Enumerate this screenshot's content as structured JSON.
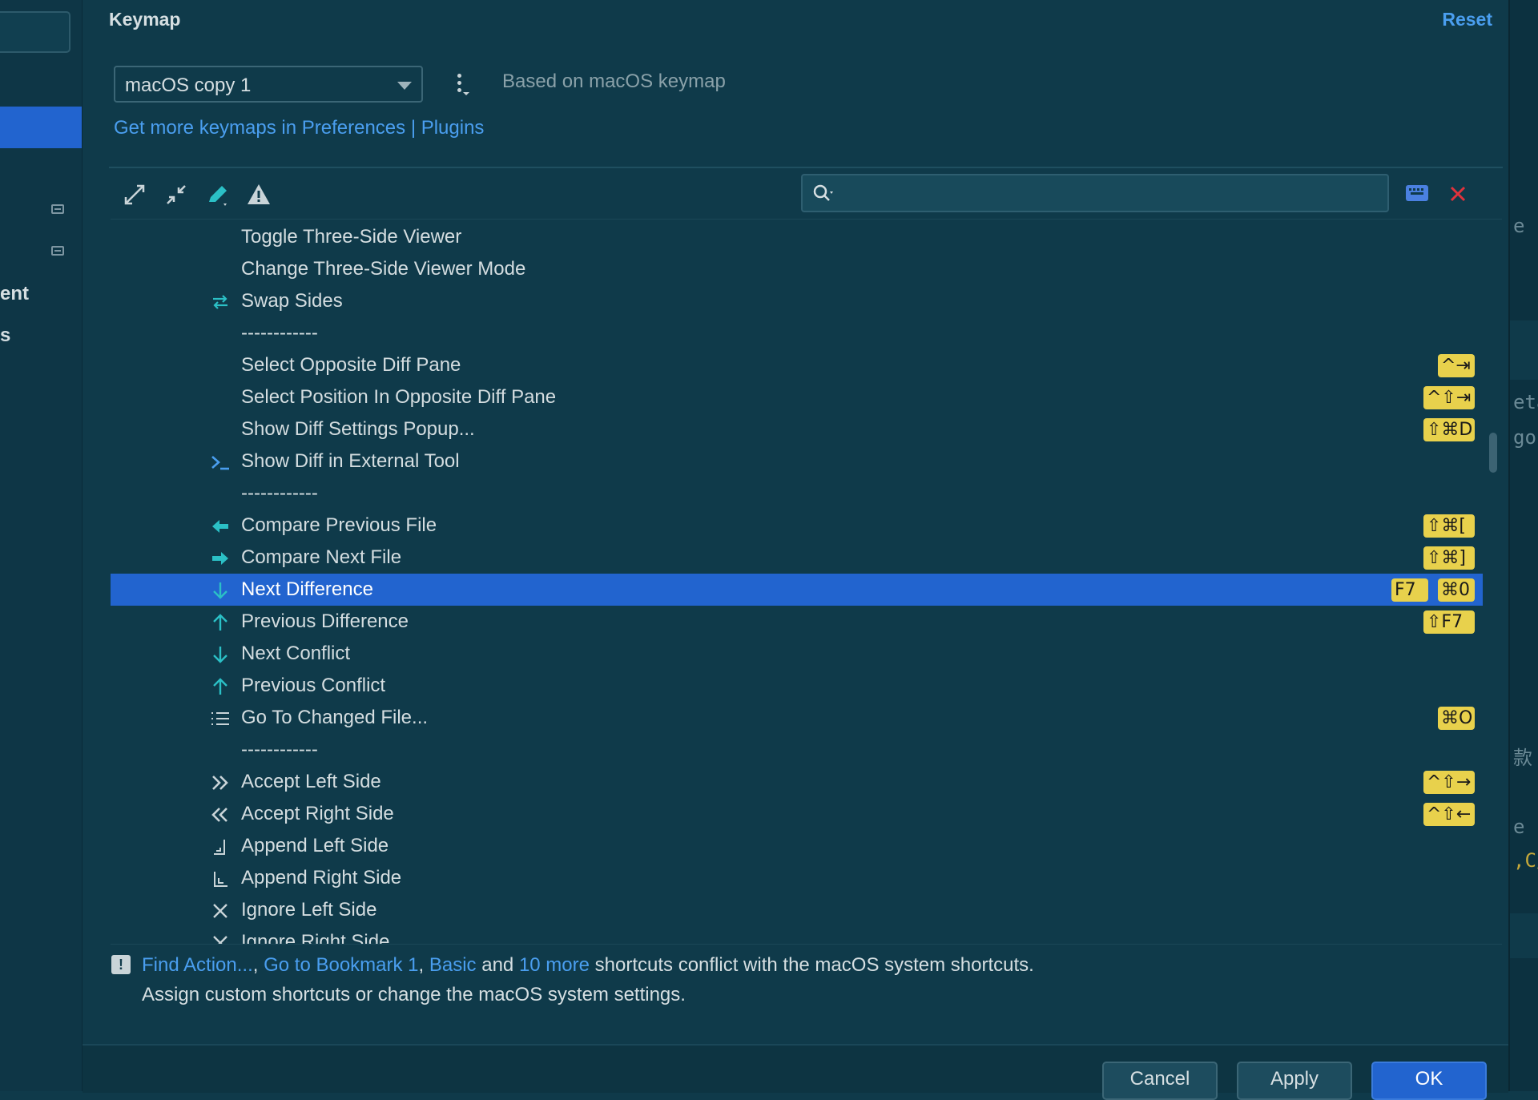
{
  "sidebar": {
    "partial_labels": [
      "ent",
      "s"
    ]
  },
  "header": {
    "title": "Keymap",
    "reset_label": "Reset"
  },
  "keymap": {
    "selected": "macOS copy 1",
    "based_on": "Based on macOS keymap",
    "get_more_link": "Get more keymaps in Preferences | Plugins"
  },
  "search": {
    "value": "",
    "placeholder": ""
  },
  "actions": [
    {
      "label": "Toggle Three-Side Viewer",
      "icon": "",
      "shortcuts": []
    },
    {
      "label": "Change Three-Side Viewer Mode",
      "icon": "",
      "shortcuts": []
    },
    {
      "label": "Swap Sides",
      "icon": "swap-icon",
      "shortcuts": []
    },
    {
      "label": "------------",
      "icon": "",
      "shortcuts": []
    },
    {
      "label": "Select Opposite Diff Pane",
      "icon": "",
      "shortcuts": [
        "^⇥"
      ]
    },
    {
      "label": "Select Position In Opposite Diff Pane",
      "icon": "",
      "shortcuts": [
        "^⇧⇥"
      ]
    },
    {
      "label": "Show Diff Settings Popup...",
      "icon": "",
      "shortcuts": [
        "⇧⌘D"
      ]
    },
    {
      "label": "Show Diff in External Tool",
      "icon": "terminal-icon",
      "shortcuts": []
    },
    {
      "label": "------------",
      "icon": "",
      "shortcuts": []
    },
    {
      "label": "Compare Previous File",
      "icon": "arrow-left-icon",
      "shortcuts": [
        "⇧⌘["
      ]
    },
    {
      "label": "Compare Next File",
      "icon": "arrow-right-icon",
      "shortcuts": [
        "⇧⌘]"
      ]
    },
    {
      "label": "Next Difference",
      "icon": "arrow-down-icon",
      "shortcuts": [
        "F7",
        "⌘0"
      ],
      "selected": true
    },
    {
      "label": "Previous Difference",
      "icon": "arrow-up-icon",
      "shortcuts": [
        "⇧F7"
      ]
    },
    {
      "label": "Next Conflict",
      "icon": "arrow-down-icon",
      "shortcuts": []
    },
    {
      "label": "Previous Conflict",
      "icon": "arrow-up-icon",
      "shortcuts": []
    },
    {
      "label": "Go To Changed File...",
      "icon": "list-icon",
      "shortcuts": [
        "⌘O"
      ]
    },
    {
      "label": "------------",
      "icon": "",
      "shortcuts": []
    },
    {
      "label": "Accept Left Side",
      "icon": "double-chevron-right-icon",
      "shortcuts": [
        "^⇧→"
      ]
    },
    {
      "label": "Accept Right Side",
      "icon": "double-chevron-left-icon",
      "shortcuts": [
        "^⇧←"
      ]
    },
    {
      "label": "Append Left Side",
      "icon": "append-left-icon",
      "shortcuts": []
    },
    {
      "label": "Append Right Side",
      "icon": "append-right-icon",
      "shortcuts": []
    },
    {
      "label": "Ignore Left Side",
      "icon": "x-icon",
      "shortcuts": []
    },
    {
      "label": "Ignore Right Side",
      "icon": "x-icon",
      "shortcuts": []
    }
  ],
  "conflict_note": {
    "link1": "Find Action...",
    "sep1": ", ",
    "link2": "Go to Bookmark 1",
    "sep2": ", ",
    "link3": "Basic",
    "mid": " and ",
    "link4": "10 more",
    "tail": " shortcuts conflict with the macOS system shortcuts.",
    "line2": "Assign custom shortcuts or change the macOS system settings."
  },
  "buttons": {
    "cancel": "Cancel",
    "apply": "Apply",
    "ok": "OK"
  },
  "right_editor": {
    "fragments": [
      "e",
      "eta",
      "gor",
      "款",
      "e",
      ",C/"
    ]
  },
  "colors": {
    "background": "#0f3a4a",
    "selection": "#2264cf",
    "link": "#4a9eef",
    "shortcut_badge": "#e8d14c",
    "close_red": "#e0323c"
  }
}
